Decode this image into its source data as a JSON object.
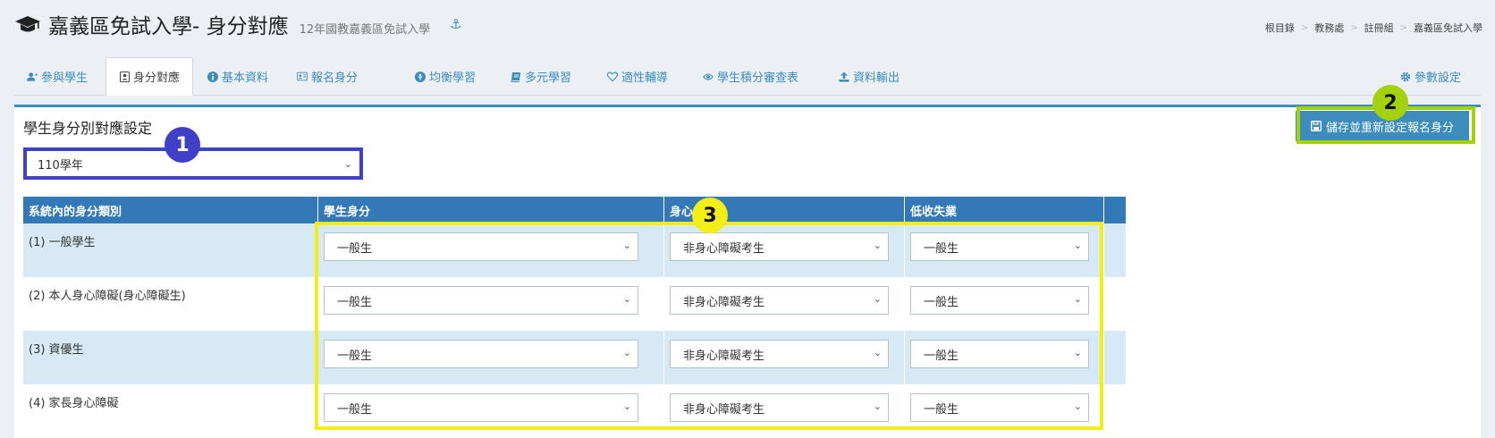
{
  "header": {
    "title": "嘉義區免試入學- 身分對應",
    "subtitle": "12年國教嘉義區免試入學",
    "breadcrumb": [
      "根目錄",
      "教務處",
      "註冊組",
      "嘉義區免試入學"
    ]
  },
  "tabs": [
    {
      "label": "參與學生",
      "icon": "users-icon"
    },
    {
      "label": "身分對應",
      "icon": "id-card-icon",
      "active": true
    },
    {
      "label": "基本資料",
      "icon": "info-icon"
    },
    {
      "label": "報名身分",
      "icon": "address-card-icon"
    },
    {
      "label": "均衡學習",
      "icon": "balance-icon"
    },
    {
      "label": "多元學習",
      "icon": "book-icon"
    },
    {
      "label": "適性輔導",
      "icon": "heart-icon"
    },
    {
      "label": "學生積分審查表",
      "icon": "eye-icon"
    },
    {
      "label": "資料輸出",
      "icon": "upload-icon"
    },
    {
      "label": "參數設定",
      "icon": "gear-icon"
    }
  ],
  "panel": {
    "title": "學生身分別對應設定",
    "save_label": "儲存並重新設定報名身分",
    "year_value": "110學年"
  },
  "table": {
    "headers": [
      "系統內的身分類別",
      "學生身分",
      "身心",
      "低收失業"
    ],
    "rows": [
      {
        "label": "(1) 一般學生",
        "student": "一般生",
        "disability": "非身心障礙考生",
        "income": "一般生"
      },
      {
        "label": "(2) 本人身心障礙(身心障礙生)",
        "student": "一般生",
        "disability": "非身心障礙考生",
        "income": "一般生"
      },
      {
        "label": "(3) 資優生",
        "student": "一般生",
        "disability": "非身心障礙考生",
        "income": "一般生"
      },
      {
        "label": "(4) 家長身心障礙",
        "student": "一般生",
        "disability": "非身心障礙考生",
        "income": "一般生"
      }
    ]
  },
  "annotations": {
    "badge1": "1",
    "badge2": "2",
    "badge3": "3"
  },
  "colors": {
    "accent": "#3c8dbc",
    "table_header": "#3479b7",
    "row_alt": "#d6e9f4",
    "highlight_blue": "#3f3fc8",
    "highlight_green": "#a4d20a",
    "highlight_yellow": "#f3ee16"
  }
}
